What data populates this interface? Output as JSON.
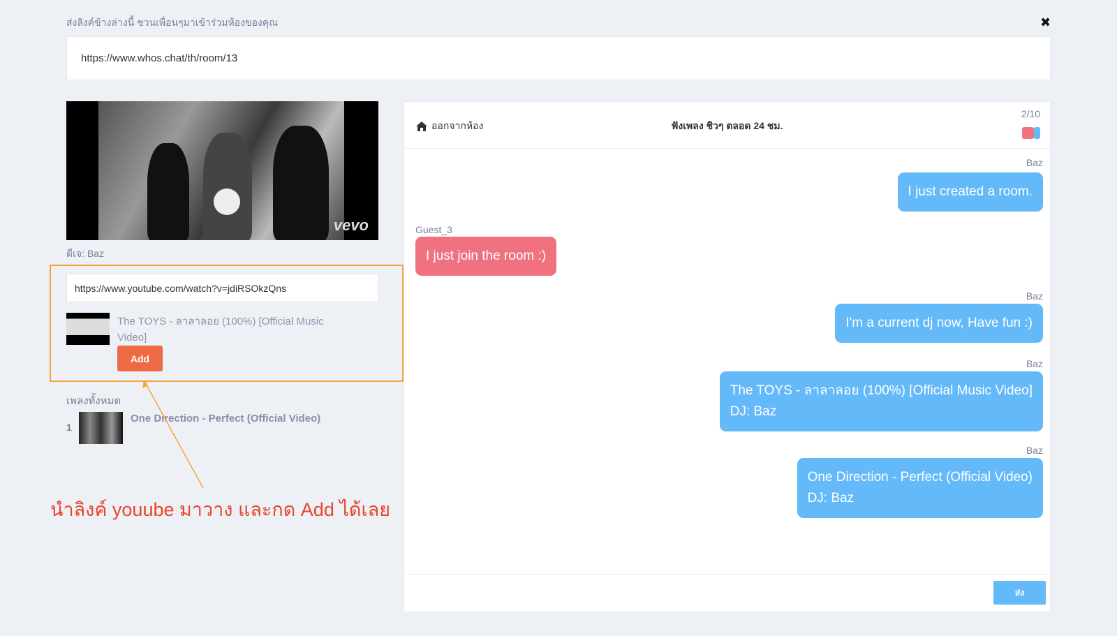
{
  "share": {
    "label": "ส่งลิงค์ข้างล่างนี้ ชวนเพื่อนๆมาเข้าร่วมห้องของคุณ",
    "url": "https://www.whos.chat/th/room/13",
    "close_icon": "close-icon"
  },
  "player": {
    "watermark": "vevo",
    "dj_label": "ดีเจ: Baz"
  },
  "add_song": {
    "input_value": "https://www.youtube.com/watch?v=jdiRSOkzQns",
    "preview_title": "The TOYS - ลาลาลอย (100%) [Official Music Video]",
    "add_label": "Add"
  },
  "playlist": {
    "heading": "เพลงทั้งหมด",
    "items": [
      {
        "number": "1",
        "title": "One Direction - Perfect (Official Video)"
      }
    ]
  },
  "annotation": {
    "text": "นำลิงค์ youube มาวาง และกด Add ได้เลย",
    "color": "#e8452a"
  },
  "chat": {
    "leave_label": "ออกจากห้อง",
    "room_title": "ฟังเพลง ชิวๆ ตลอด 24 ชม.",
    "user_count": "2/10",
    "user_colors": [
      "#f07280",
      "#64b9f8"
    ],
    "messages": [
      {
        "sender": "Baz",
        "side": "right",
        "lines": [
          "I just created a room."
        ]
      },
      {
        "sender": "Guest_3",
        "side": "left",
        "lines": [
          "I just join the room :)"
        ]
      },
      {
        "sender": "Baz",
        "side": "right",
        "lines": [
          "I'm a current dj now, Have fun :)"
        ]
      },
      {
        "sender": "Baz",
        "side": "right",
        "lines": [
          "The TOYS - ลาลาลอย (100%) [Official Music Video]",
          "DJ: Baz"
        ]
      },
      {
        "sender": "Baz",
        "side": "right",
        "lines": [
          "One Direction - Perfect (Official Video)",
          "DJ: Baz"
        ]
      }
    ],
    "input_value": "",
    "send_label": "ส่ง"
  },
  "colors": {
    "self_bubble": "#64b9f8",
    "other_bubble": "#f07280",
    "add_button": "#ee6a45",
    "highlight_box": "#f6a340"
  }
}
